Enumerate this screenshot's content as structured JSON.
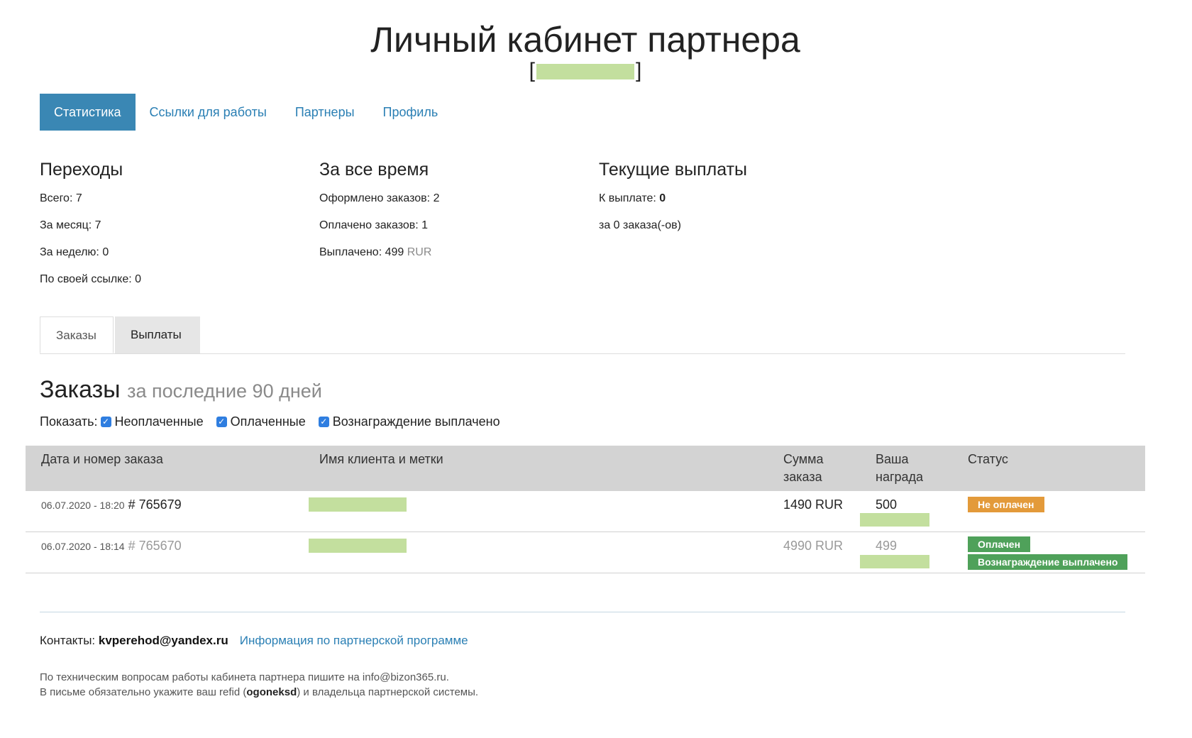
{
  "header": {
    "title": "Личный кабинет партнера",
    "subtitle_left": "[",
    "subtitle_right": "]"
  },
  "nav": [
    {
      "label": "Статистика",
      "active": true
    },
    {
      "label": "Ссылки для работы",
      "active": false
    },
    {
      "label": "Партнеры",
      "active": false
    },
    {
      "label": "Профиль",
      "active": false
    }
  ],
  "stats": {
    "clicks": {
      "title": "Переходы",
      "rows": [
        "Всего: 7",
        "За месяц: 7",
        "За неделю: 0",
        "По своей ссылке: 0"
      ]
    },
    "alltime": {
      "title": "За все время",
      "orders_created": "Оформлено заказов: 2",
      "orders_paid": "Оплачено заказов: 1",
      "paid_out_label": "Выплачено: 499",
      "paid_out_currency": "RUR"
    },
    "payouts": {
      "title": "Текущие выплаты",
      "to_pay_label": "К выплате: ",
      "to_pay_value": "0",
      "orders_count": "за 0 заказа(-ов)"
    }
  },
  "tabs": [
    {
      "label": "Заказы",
      "active": true
    },
    {
      "label": "Выплаты",
      "active": false
    }
  ],
  "orders": {
    "title": "Заказы",
    "subtitle": "за последние 90 дней",
    "filter_label": "Показать:",
    "filters": [
      {
        "label": "Неоплаченные",
        "checked": true
      },
      {
        "label": "Оплаченные",
        "checked": true
      },
      {
        "label": "Вознаграждение выплачено",
        "checked": true
      }
    ],
    "columns": {
      "date": "Дата и номер заказа",
      "client": "Имя клиента и метки",
      "sum_line1": "Сумма",
      "sum_line2": "заказа",
      "reward_line1": "Ваша",
      "reward_line2": "награда",
      "status": "Статус"
    },
    "rows": [
      {
        "date": "06.07.2020 - 18:20",
        "number": "# 765679",
        "sum": "1490 RUR",
        "reward": "500",
        "statuses": [
          {
            "label": "Не оплачен",
            "color": "#e39a3a"
          }
        ]
      },
      {
        "date": "06.07.2020 - 18:14",
        "number": "# 765670",
        "sum": "4990 RUR",
        "reward": "499",
        "statuses": [
          {
            "label": "Оплачен",
            "color": "#4fa15a"
          },
          {
            "label": "Вознаграждение выплачено",
            "color": "#4fa15a"
          }
        ]
      }
    ]
  },
  "footer": {
    "contacts_label": "Контакты: ",
    "contacts_email": "kvperehod@yandex.ru",
    "program_link": "Информация по партнерской программе",
    "note_line1": "По техническим вопросам работы кабинета партнера пишите на info@bizon365.ru.",
    "note_line2_a": "В письме обязательно укажите ваш refid (",
    "note_line2_refid": "ogoneksd",
    "note_line2_b": ") и владельца партнерской системы."
  },
  "colors": {
    "accent": "#3a87b4",
    "link": "#2a7fb4",
    "unpaid": "#e39a3a",
    "paid": "#4fa15a",
    "redaction": "#c3df9e"
  }
}
